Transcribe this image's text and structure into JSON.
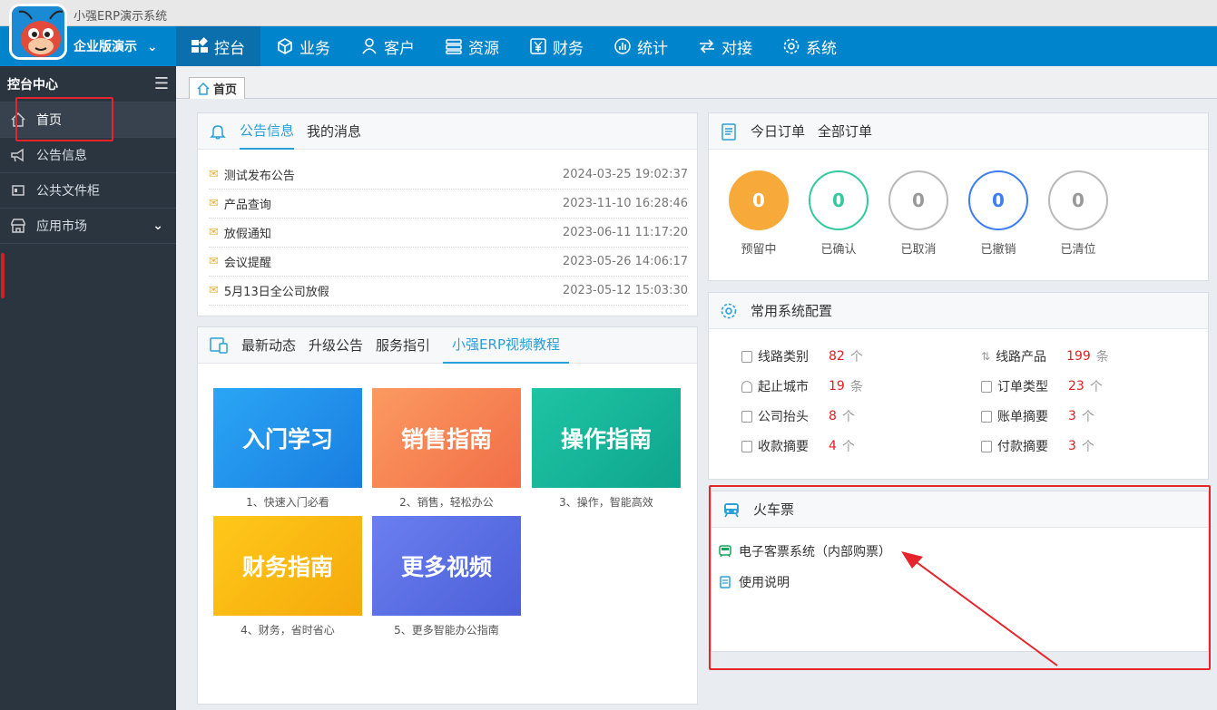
{
  "app_title": "小强ERP演示系统",
  "edition": "企业版演示",
  "nav": [
    {
      "label": "控台",
      "icon": "dashboard-icon"
    },
    {
      "label": "业务",
      "icon": "cube-icon"
    },
    {
      "label": "客户",
      "icon": "user-icon"
    },
    {
      "label": "资源",
      "icon": "database-icon"
    },
    {
      "label": "财务",
      "icon": "yen-icon"
    },
    {
      "label": "统计",
      "icon": "chart-icon"
    },
    {
      "label": "对接",
      "icon": "exchange-icon"
    },
    {
      "label": "系统",
      "icon": "gear-icon"
    }
  ],
  "sidebar": {
    "title": "控台中心",
    "items": [
      {
        "label": "首页",
        "icon": "home-icon"
      },
      {
        "label": "公告信息",
        "icon": "megaphone-icon"
      },
      {
        "label": "公共文件柜",
        "icon": "cabinet-icon"
      },
      {
        "label": "应用市场",
        "icon": "store-icon"
      }
    ]
  },
  "page_tab": "首页",
  "notices": {
    "tabs": [
      "公告信息",
      "我的消息"
    ],
    "rows": [
      {
        "title": "测试发布公告",
        "date": "2024-03-25 19:02:37"
      },
      {
        "title": "产品查询",
        "date": "2023-11-10 16:28:46"
      },
      {
        "title": "放假通知",
        "date": "2023-06-11 11:17:20"
      },
      {
        "title": "会议提醒",
        "date": "2023-05-26 14:06:17"
      },
      {
        "title": "5月13日全公司放假",
        "date": "2023-05-12 15:03:30"
      }
    ]
  },
  "news": {
    "tabs": [
      "最新动态",
      "升级公告",
      "服务指引",
      "小强ERP视频教程"
    ],
    "cards": [
      {
        "title": "入门学习",
        "caption": "1、快速入门必看",
        "color": "#1e90e8"
      },
      {
        "title": "销售指南",
        "caption": "2、销售，轻松办公",
        "color": "#f7834f"
      },
      {
        "title": "操作指南",
        "caption": "3、操作，智能高效",
        "color": "#16b79a"
      },
      {
        "title": "财务指南",
        "caption": "4、财务，省时省心",
        "color": "#f7bb12"
      },
      {
        "title": "更多视频",
        "caption": "5、更多智能办公指南",
        "color": "#5a6ee0"
      }
    ]
  },
  "orders": {
    "tabs": [
      "今日订单",
      "全部订单"
    ],
    "stats": [
      {
        "value": "0",
        "label": "预留中",
        "color": "#f7a93a"
      },
      {
        "value": "0",
        "label": "已确认",
        "color": "#35c9a0"
      },
      {
        "value": "0",
        "label": "已取消",
        "color": "#b9b9b9"
      },
      {
        "value": "0",
        "label": "已撤销",
        "color": "#3f7ef2"
      },
      {
        "value": "0",
        "label": "已清位",
        "color": "#b9b9b9"
      }
    ]
  },
  "config": {
    "title": "常用系统配置",
    "items": [
      {
        "label": "线路类别",
        "num": "82",
        "unit": "个"
      },
      {
        "label": "线路产品",
        "num": "199",
        "unit": "条"
      },
      {
        "label": "起止城市",
        "num": "19",
        "unit": "条"
      },
      {
        "label": "订单类型",
        "num": "23",
        "unit": "个"
      },
      {
        "label": "公司抬头",
        "num": "8",
        "unit": "个"
      },
      {
        "label": "账单摘要",
        "num": "3",
        "unit": "个"
      },
      {
        "label": "收款摘要",
        "num": "4",
        "unit": "个"
      },
      {
        "label": "付款摘要",
        "num": "3",
        "unit": "个"
      }
    ]
  },
  "train": {
    "title": "火车票",
    "links": [
      "电子客票系统（内部购票）",
      "使用说明"
    ]
  }
}
